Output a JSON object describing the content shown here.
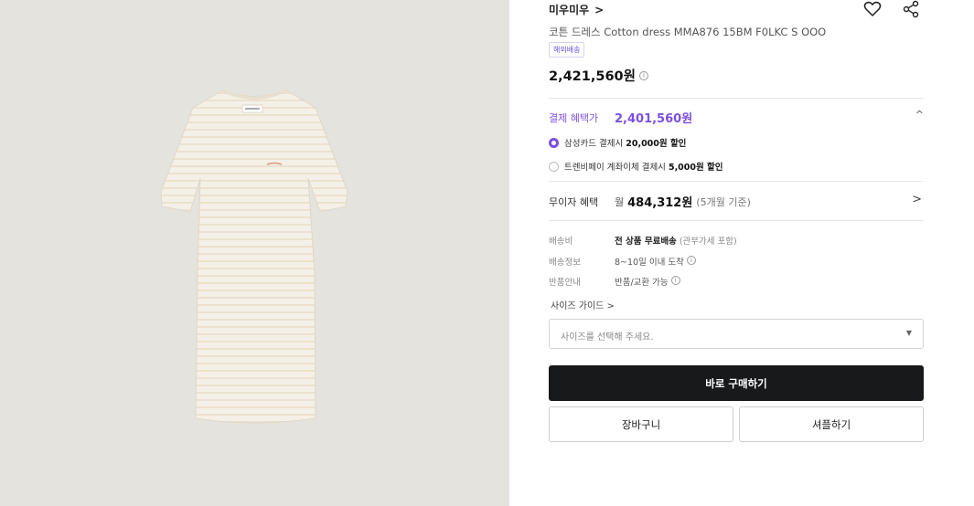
{
  "product": {
    "brand": "미우미우",
    "brand_chevron": ">",
    "name": "코튼 드레스 Cotton dress MMA876 15BM F0LKC S OOO",
    "badge": "해외배송",
    "price": "2,421,560원",
    "info_glyph": "i"
  },
  "payment": {
    "label": "결제 혜택가",
    "price": "2,401,560원",
    "chevron": "^",
    "options": [
      {
        "prefix": "삼성카드 결제시 ",
        "amount": "20,000원 할인",
        "selected": true
      },
      {
        "prefix": "트렌비페이 계좌이체 결제시 ",
        "amount": "5,000원 할인",
        "selected": false
      }
    ]
  },
  "installment": {
    "label": "무이자 혜택",
    "prefix": "월",
    "amount": "484,312원",
    "sub": "(5개월 기준)",
    "chevron": ">"
  },
  "details": [
    {
      "label": "배송비",
      "value": "전 상품 무료배송",
      "sub": " (관부가세 포함)"
    },
    {
      "label": "배송정보",
      "value": "8~10일 이내 도착",
      "sub": ""
    },
    {
      "label": "반품안내",
      "value": "반품/교환 가능",
      "sub": ""
    }
  ],
  "size_guide": "사이즈 가이드 >",
  "size_select": {
    "placeholder": "사이즈를 선택해 주세요.",
    "caret": "▼"
  },
  "buttons": {
    "buy": "바로 구매하기",
    "cart": "장바구니",
    "showroom": "셔플하기"
  },
  "icons": {
    "wishlist": "heart-icon",
    "share": "share-icon"
  },
  "colors": {
    "accent": "#7b4fe0",
    "buy_bg": "#17191b",
    "image_bg": "#e5e3dd",
    "dress": "#f4efe6"
  }
}
